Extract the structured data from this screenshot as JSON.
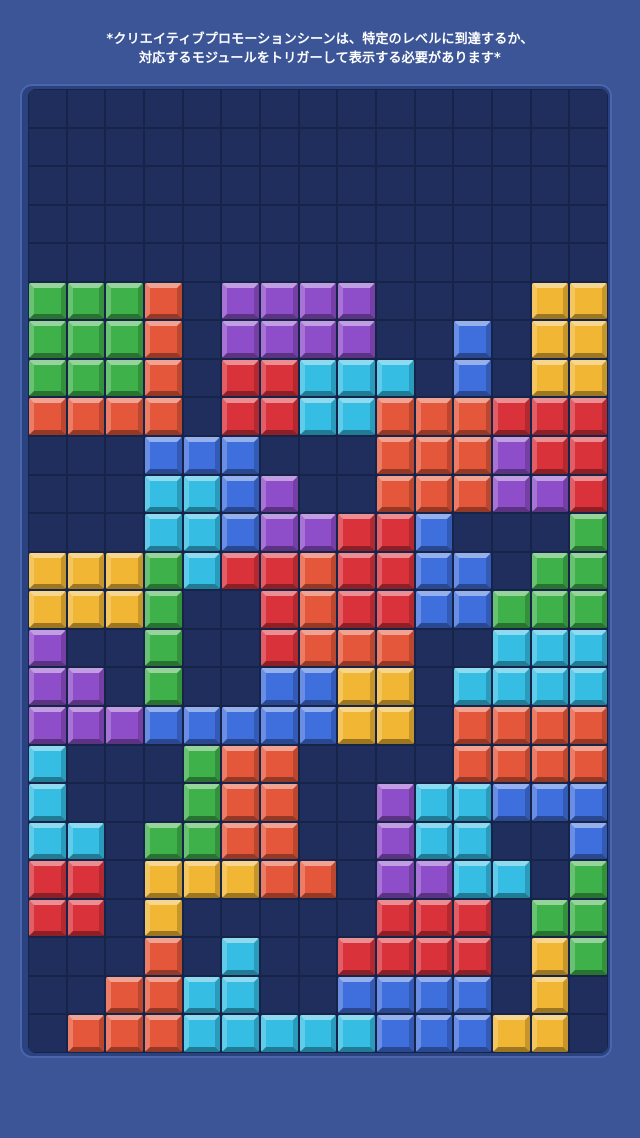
{
  "header": {
    "notice_line1": "*クリエイティブプロモーションシーンは、特定のレベルに到達するか、",
    "notice_line2": "対応するモジュールをトリガーして表示する必要があります*"
  },
  "board": {
    "cols": 15,
    "rows": 25,
    "palette": {
      "G": "#3fb14a",
      "R": "#e5573a",
      "D": "#d9323b",
      "P": "#8e4dc9",
      "B": "#3f6fdc",
      "C": "#35bde3",
      "Y": "#f1b634"
    },
    "grid": [
      "...............",
      "...............",
      "...............",
      "...............",
      "...............",
      "GGGR.PPPP....YY",
      "GGGR.PPPP..B.YY",
      "GGGR.DDCCC.B.YY",
      "RRRR.DDCCRRRDDD",
      "...BBB...RRRPDD",
      "...CCBP..RRRPPD",
      "...CCBPPDDB...G",
      "YYYGCDDRDDBB.GG",
      "YYYG..DRDDBBGGG",
      "P..G..DRRR..CCC",
      "PP.G..BBYY.CCCC",
      "PPPBBBBBYY.RRRR",
      "C...GRR....RRRR",
      "C...GRR..PCCBBB",
      "CC.GGRR..PCC..B",
      "DD.YYYRR.PPCC.G",
      "DD.Y.....DDD.GG",
      "...R.C..DDDD.YGG",
      "..RRCC..BBBB.Y..",
      ".RRRCCCCCBBBYY.."
    ]
  }
}
